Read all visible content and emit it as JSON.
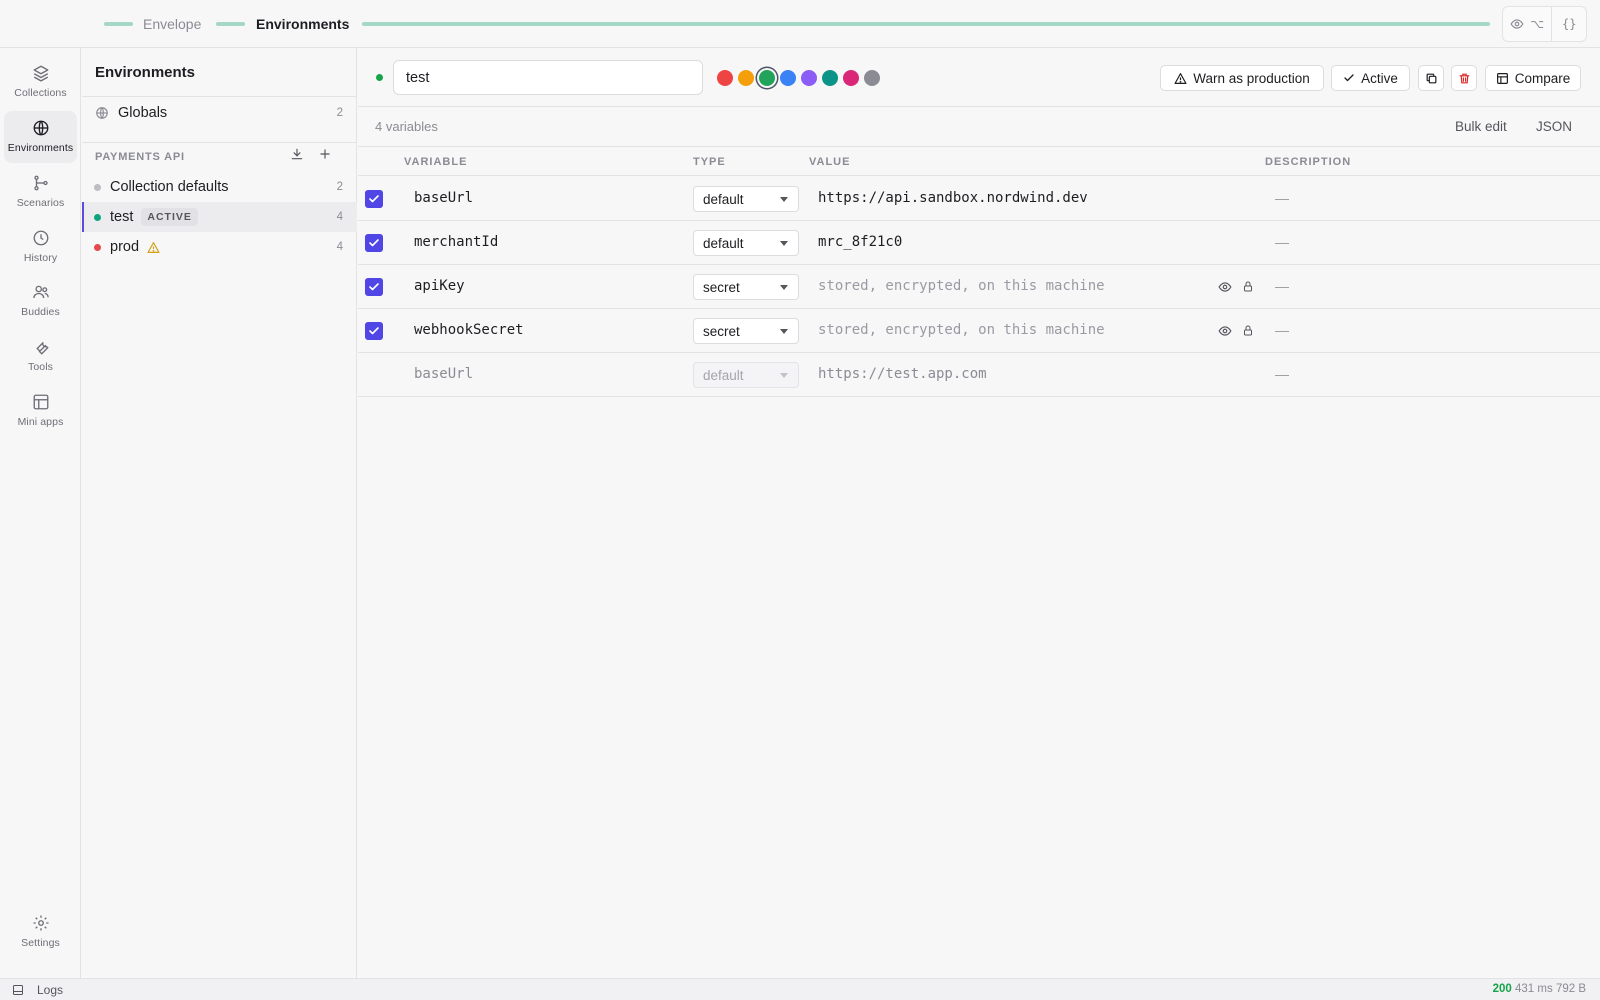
{
  "breadcrumb": {
    "parent": "Envelope",
    "current": "Environments"
  },
  "top_actions": {
    "preview_shortcut": "⌥",
    "json_toggle": "{}"
  },
  "rail": {
    "items": [
      {
        "label": "Collections",
        "icon": "layers-icon"
      },
      {
        "label": "Environments",
        "icon": "globe-icon",
        "active": true
      },
      {
        "label": "Scenarios",
        "icon": "branch-icon"
      },
      {
        "label": "History",
        "icon": "clock-icon"
      },
      {
        "label": "Buddies",
        "icon": "users-icon"
      },
      {
        "label": "Tools",
        "icon": "wrench-icon"
      },
      {
        "label": "Mini apps",
        "icon": "layout-icon"
      }
    ],
    "settings_label": "Settings"
  },
  "sidebar": {
    "title": "Environments",
    "globals": {
      "label": "Globals",
      "count": "2"
    },
    "section_title": "PAYMENTS API",
    "envs": [
      {
        "label": "Collection defaults",
        "count": "2",
        "color": "#bdbdc2"
      },
      {
        "label": "test",
        "count": "4",
        "color": "#10a37f",
        "badge": "ACTIVE"
      },
      {
        "label": "prod",
        "count": "4",
        "color": "#e5484d",
        "warning": true
      }
    ]
  },
  "editor": {
    "env_name": "test",
    "env_color": "#16a34a",
    "swatches": [
      "#ef4444",
      "#f59e0b",
      "#22a35a",
      "#3b82f6",
      "#8b5cf6",
      "#0d9488",
      "#db2777",
      "#8b8b93"
    ],
    "selected_swatch": 2,
    "buttons": {
      "warn": "Warn as production",
      "active": "Active",
      "compare": "Compare"
    },
    "variable_count": "4 variables",
    "bulk_edit": "Bulk edit",
    "json": "JSON",
    "columns": {
      "variable": "VARIABLE",
      "type": "TYPE",
      "value": "VALUE",
      "description": "DESCRIPTION"
    },
    "rows": [
      {
        "name": "baseUrl",
        "type": "default",
        "value": "https://api.sandbox.nordwind.dev",
        "description": "—",
        "enabled": true,
        "secret": false
      },
      {
        "name": "merchantId",
        "type": "default",
        "value": "mrc_8f21c0",
        "description": "—",
        "enabled": true,
        "secret": false
      },
      {
        "name": "apiKey",
        "type": "secret",
        "value": "stored, encrypted, on this machine",
        "description": "—",
        "enabled": true,
        "secret": true
      },
      {
        "name": "webhookSecret",
        "type": "secret",
        "value": "stored, encrypted, on this machine",
        "description": "—",
        "enabled": true,
        "secret": true
      },
      {
        "name": "baseUrl",
        "type": "default",
        "value": "https://test.app.com",
        "description": "—",
        "enabled": false,
        "secret": false
      }
    ]
  },
  "statusbar": {
    "logs": "Logs",
    "status_code": "200",
    "timing": "431 ms",
    "size": "792 B"
  }
}
